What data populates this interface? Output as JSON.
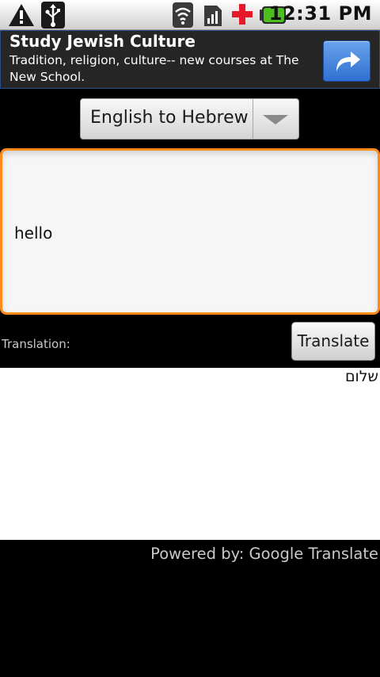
{
  "status_bar": {
    "time": "12:31 PM",
    "icons": [
      "warning-icon",
      "usb-icon",
      "wifi-icon",
      "signal-icon",
      "red-cross-icon",
      "battery-icon"
    ]
  },
  "ad": {
    "title": "Study Jewish Culture",
    "description": "Tradition, religion, culture-- new courses at The New School.",
    "button_icon": "share-arrow-icon"
  },
  "language": {
    "selected": "English to Hebrew"
  },
  "input": {
    "value": "hello"
  },
  "translation": {
    "label": "Translation:",
    "button_label": "Translate",
    "result": "שלום"
  },
  "footer": {
    "powered_by": "Powered by: Google Translate"
  },
  "colors": {
    "input_focus_border": "#ff8a1a",
    "battery": "#4cbf1e",
    "red_cross": "#e8182b",
    "ad_accent": "#2f6fd0"
  }
}
